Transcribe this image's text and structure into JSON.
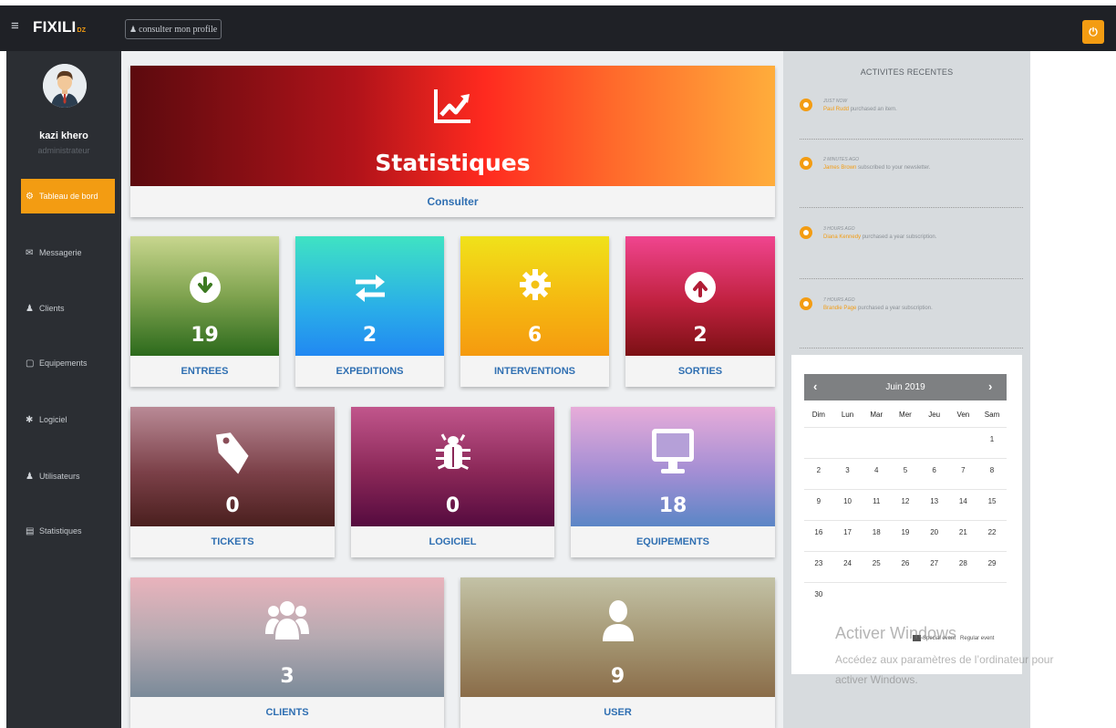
{
  "topbar": {
    "brand": "FIXILI",
    "brand_suffix": "DZ",
    "profile_button": "consulter mon profile"
  },
  "user": {
    "name": "kazi khero",
    "role": "administrateur"
  },
  "sidebar": {
    "items": [
      {
        "label": "Tableau de bord",
        "icon": "dashboard-icon",
        "active": true
      },
      {
        "label": "Messagerie",
        "icon": "envelope-icon",
        "active": false
      },
      {
        "label": "Clients",
        "icon": "users-icon",
        "active": false
      },
      {
        "label": "Equipements",
        "icon": "monitor-icon",
        "active": false
      },
      {
        "label": "Logiciel",
        "icon": "bug-icon",
        "active": false
      },
      {
        "label": "Utilisateurs",
        "icon": "users-icon",
        "active": false
      },
      {
        "label": "Statistiques",
        "icon": "bar-chart-icon",
        "active": false
      }
    ]
  },
  "banner": {
    "title": "Statistiques",
    "action": "Consulter"
  },
  "cards": [
    {
      "label": "ENTREES",
      "value": "19",
      "icon": "arrow-down-circle-icon"
    },
    {
      "label": "EXPEDITIONS",
      "value": "2",
      "icon": "exchange-arrows-icon"
    },
    {
      "label": "INTERVENTIONS",
      "value": "6",
      "icon": "gear-icon"
    },
    {
      "label": "SORTIES",
      "value": "2",
      "icon": "arrow-up-circle-icon"
    },
    {
      "label": "TICKETS",
      "value": "0",
      "icon": "tag-icon"
    },
    {
      "label": "LOGICIEL",
      "value": "0",
      "icon": "bug-icon"
    },
    {
      "label": "EQUIPEMENTS",
      "value": "18",
      "icon": "desktop-icon"
    },
    {
      "label": "CLIENTS",
      "value": "3",
      "icon": "users-group-icon"
    },
    {
      "label": "USER",
      "value": "9",
      "icon": "user-icon"
    }
  ],
  "activities": {
    "title": "ACTIVITES RECENTES",
    "items": [
      {
        "when": "JUST NOW",
        "who": "Paul Rudd",
        "text": "purchased an item."
      },
      {
        "when": "2 MINUTES AGO",
        "who": "James Brown",
        "text": "subscribed to your newsletter."
      },
      {
        "when": "3 HOURS AGO",
        "who": "Diana Kennedy",
        "text": "purchased a year subscription."
      },
      {
        "when": "7 HOURS AGO",
        "who": "Brandie Page",
        "text": "purchased a year subscription."
      }
    ]
  },
  "calendar": {
    "month": "Juin 2019",
    "prev": "‹",
    "next": "›",
    "days": [
      "Dim",
      "Lun",
      "Mar",
      "Mer",
      "Jeu",
      "Ven",
      "Sam"
    ],
    "weeks": [
      [
        "",
        "",
        "",
        "",
        "",
        "",
        "1"
      ],
      [
        "2",
        "3",
        "4",
        "5",
        "6",
        "7",
        "8"
      ],
      [
        "9",
        "10",
        "11",
        "12",
        "13",
        "14",
        "15"
      ],
      [
        "16",
        "17",
        "18",
        "19",
        "20",
        "21",
        "22"
      ],
      [
        "23",
        "24",
        "25",
        "26",
        "27",
        "28",
        "29"
      ],
      [
        "30",
        "",
        "",
        "",
        "",
        "",
        ""
      ]
    ],
    "legend": {
      "special": "Special event",
      "regular": "Regular event"
    }
  },
  "watermark": {
    "line1": "Activer Windows",
    "line2": "Accédez aux paramètres de l’ordinateur pour",
    "line3": "activer Windows."
  },
  "colors": {
    "accent": "#f39c12",
    "sidebar": "#2b2e33",
    "topbar": "#1f2126",
    "link": "#2f6fb2"
  }
}
